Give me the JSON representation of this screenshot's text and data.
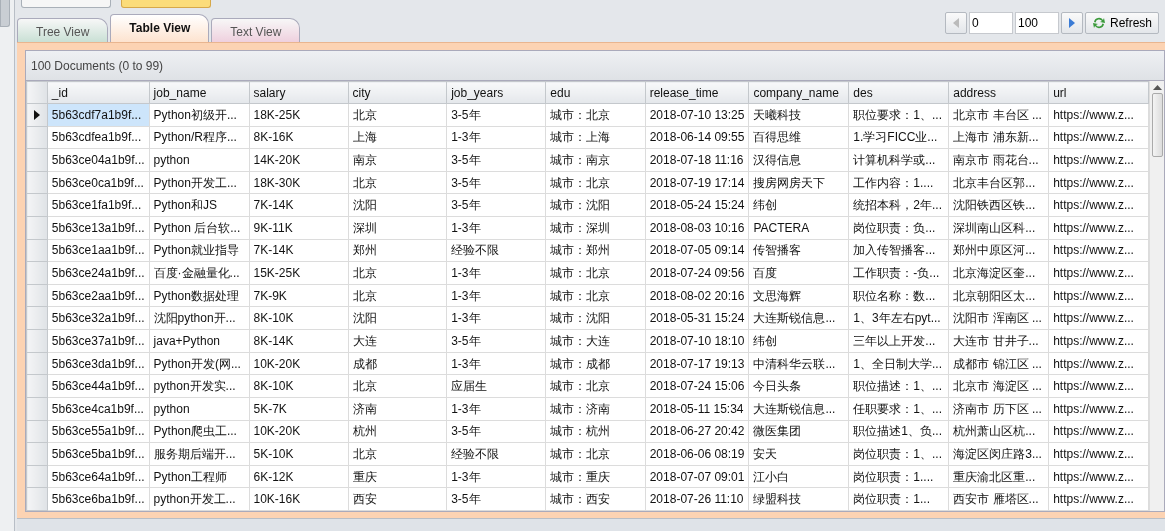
{
  "tabs": [
    {
      "label": "Tree View",
      "selected": false,
      "color": "#c9e0d5"
    },
    {
      "label": "Table View",
      "selected": true,
      "color": "#fde3cf"
    },
    {
      "label": "Text View",
      "selected": false,
      "color": "#efd0de"
    }
  ],
  "pager": {
    "start": "0",
    "count": "100",
    "refresh": "Refresh"
  },
  "summary": "100 Documents (0 to 99)",
  "columns": [
    "_id",
    "job_name",
    "salary",
    "city",
    "job_years",
    "edu",
    "release_time",
    "company_name",
    "des",
    "address",
    "url"
  ],
  "rows": [
    {
      "selected": true,
      "cells": [
        "5b63cdf7a1b9f...",
        "Python初级开...",
        "18K-25K",
        "北京",
        "3-5年",
        "城市：北京",
        "2018-07-10 13:25",
        "天曦科技",
        "职位要求：1、...",
        "北京市 丰台区 ...",
        "https://www.z..."
      ]
    },
    {
      "selected": false,
      "cells": [
        "5b63cdfea1b9f...",
        "Python/R程序...",
        "8K-16K",
        "上海",
        "1-3年",
        "城市：上海",
        "2018-06-14 09:55",
        "百得思维",
        "1.学习FICC业...",
        "上海市 浦东新...",
        "https://www.z..."
      ]
    },
    {
      "selected": false,
      "cells": [
        "5b63ce04a1b9f...",
        "python",
        "14K-20K",
        "南京",
        "3-5年",
        "城市：南京",
        "2018-07-18 11:16",
        "汉得信息",
        "计算机科学或...",
        "南京市 雨花台...",
        "https://www.z..."
      ]
    },
    {
      "selected": false,
      "cells": [
        "5b63ce0ca1b9f...",
        "Python开发工...",
        "18K-30K",
        "北京",
        "3-5年",
        "城市：北京",
        "2018-07-19 17:14",
        "搜房网房天下",
        "工作内容：1....",
        "北京丰台区郭...",
        "https://www.z..."
      ]
    },
    {
      "selected": false,
      "cells": [
        "5b63ce1fa1b9f...",
        "Python和JS",
        "7K-14K",
        "沈阳",
        "3-5年",
        "城市：沈阳",
        "2018-05-24 15:24",
        "纬创",
        "统招本科，2年...",
        "沈阳铁西区铁...",
        "https://www.z..."
      ]
    },
    {
      "selected": false,
      "cells": [
        "5b63ce13a1b9f...",
        "Python 后台软...",
        "9K-11K",
        "深圳",
        "1-3年",
        "城市：深圳",
        "2018-08-03 10:16",
        "PACTERA",
        "岗位职责：负...",
        "深圳南山区科...",
        "https://www.z..."
      ]
    },
    {
      "selected": false,
      "cells": [
        "5b63ce1aa1b9f...",
        "Python就业指导",
        "7K-14K",
        "郑州",
        "经验不限",
        "城市：郑州",
        "2018-07-05 09:14",
        "传智播客",
        "加入传智播客...",
        "郑州中原区河...",
        "https://www.z..."
      ]
    },
    {
      "selected": false,
      "cells": [
        "5b63ce24a1b9f...",
        "百度·金融量化...",
        "15K-25K",
        "北京",
        "1-3年",
        "城市：北京",
        "2018-07-24 09:56",
        "百度",
        "工作职责：-负...",
        "北京海淀区奎...",
        "https://www.z..."
      ]
    },
    {
      "selected": false,
      "cells": [
        "5b63ce2aa1b9f...",
        "Python数据处理",
        "7K-9K",
        "北京",
        "1-3年",
        "城市：北京",
        "2018-08-02 20:16",
        "文思海辉",
        "职位名称：数...",
        "北京朝阳区太...",
        "https://www.z..."
      ]
    },
    {
      "selected": false,
      "cells": [
        "5b63ce32a1b9f...",
        "沈阳python开...",
        "8K-10K",
        "沈阳",
        "1-3年",
        "城市：沈阳",
        "2018-05-31 15:24",
        "大连斯锐信息...",
        "1、3年左右pyt...",
        "沈阳市 浑南区 ...",
        "https://www.z..."
      ]
    },
    {
      "selected": false,
      "cells": [
        "5b63ce37a1b9f...",
        "java+Python",
        "8K-14K",
        "大连",
        "3-5年",
        "城市：大连",
        "2018-07-10 18:10",
        "纬创",
        "三年以上开发...",
        "大连市 甘井子...",
        "https://www.z..."
      ]
    },
    {
      "selected": false,
      "cells": [
        "5b63ce3da1b9f...",
        "Python开发(网...",
        "10K-20K",
        "成都",
        "1-3年",
        "城市：成都",
        "2018-07-17 19:13",
        "中清科华云联...",
        "1、全日制大学...",
        "成都市 锦江区 ...",
        "https://www.z..."
      ]
    },
    {
      "selected": false,
      "cells": [
        "5b63ce44a1b9f...",
        "python开发实...",
        "8K-10K",
        "北京",
        "应届生",
        "城市：北京",
        "2018-07-24 15:06",
        "今日头条",
        "职位描述：1、...",
        "北京市 海淀区 ...",
        "https://www.z..."
      ]
    },
    {
      "selected": false,
      "cells": [
        "5b63ce4ca1b9f...",
        "python",
        "5K-7K",
        "济南",
        "1-3年",
        "城市：济南",
        "2018-05-11 15:34",
        "大连斯锐信息...",
        "任职要求：1、...",
        "济南市 历下区 ...",
        "https://www.z..."
      ]
    },
    {
      "selected": false,
      "cells": [
        "5b63ce55a1b9f...",
        "Python爬虫工...",
        "10K-20K",
        "杭州",
        "3-5年",
        "城市：杭州",
        "2018-06-27 20:42",
        "微医集团",
        "职位描述1、负...",
        "杭州萧山区杭...",
        "https://www.z..."
      ]
    },
    {
      "selected": false,
      "cells": [
        "5b63ce5ba1b9f...",
        "服务期后端开...",
        "5K-10K",
        "北京",
        "经验不限",
        "城市：北京",
        "2018-06-06 08:19",
        "安天",
        "岗位职责：1、...",
        "海淀区闵庄路3...",
        "https://www.z..."
      ]
    },
    {
      "selected": false,
      "cells": [
        "5b63ce64a1b9f...",
        "Python工程师",
        "6K-12K",
        "重庆",
        "1-3年",
        "城市：重庆",
        "2018-07-07 09:01",
        "江小白",
        "岗位职责：1....",
        "重庆渝北区重...",
        "https://www.z..."
      ]
    },
    {
      "selected": false,
      "cells": [
        "5b63ce6ba1b9f...",
        "python开发工...",
        "10K-16K",
        "西安",
        "3-5年",
        "城市：西安",
        "2018-07-26 11:10",
        "绿盟科技",
        "岗位职责：1...",
        "西安市 雁塔区...",
        "https://www.z..."
      ]
    }
  ]
}
